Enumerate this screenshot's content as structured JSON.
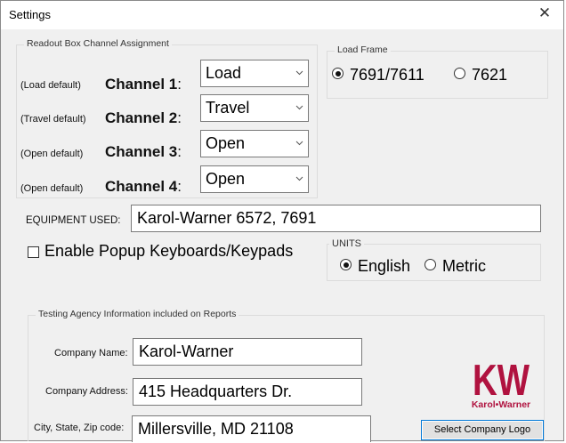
{
  "window": {
    "title": "Settings"
  },
  "readout": {
    "legend": "Readout Box Channel Assignment",
    "rows": [
      {
        "default_label": "(Load default)",
        "channel_label": "Channel 1",
        "value": "Load"
      },
      {
        "default_label": "(Travel default)",
        "channel_label": "Channel 2",
        "value": "Travel"
      },
      {
        "default_label": "(Open default)",
        "channel_label": "Channel 3",
        "value": "Open"
      },
      {
        "default_label": "(Open default)",
        "channel_label": "Channel 4",
        "value": "Open"
      }
    ],
    "colon": ":"
  },
  "load_frame": {
    "legend": "Load Frame",
    "options": [
      {
        "label": "7691/7611",
        "selected": true
      },
      {
        "label": "7621",
        "selected": false
      }
    ]
  },
  "equipment": {
    "label": "EQUIPMENT USED:",
    "value": "Karol-Warner 6572, 7691"
  },
  "popup": {
    "label": "Enable Popup Keyboards/Keypads",
    "checked": false
  },
  "units": {
    "legend": "UNITS",
    "options": [
      {
        "label": "English",
        "selected": true
      },
      {
        "label": "Metric",
        "selected": false
      }
    ]
  },
  "agency": {
    "legend": "Testing Agency Information included on Reports",
    "company_name_label": "Company Name:",
    "company_name": "Karol-Warner",
    "address_label": "Company Address:",
    "address": "415 Headquarters Dr.",
    "city_label": "City, State, Zip code:",
    "city": "Millersville, MD 21108",
    "logo_text": "KW",
    "logo_caption": "Karol-Warner",
    "logo_button": "Select Company Logo",
    "logo_color": "#b0123f"
  }
}
